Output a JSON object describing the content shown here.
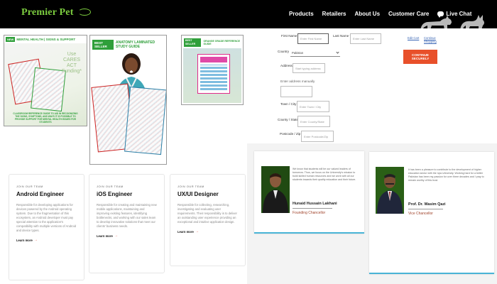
{
  "nav": {
    "logo": "Premier Pet",
    "links": [
      "Products",
      "Retailers",
      "About Us",
      "Customer Care"
    ],
    "live_chat": "Live Chat"
  },
  "products": {
    "mental_health": {
      "new_badge": "NEW",
      "title": "MENTAL HEALTH | SIGNS & SUPPORT",
      "cares": "Use CARES ACT Funding*",
      "footer": "CLASSROOM REFERENCE GUIDE TO AID IN RECOGNIZING THE SIGNS, SYMPTOMS, AND WAYS IT IS POSSIBLE TO PROVIDE SUPPORT FOR MENTAL HEALTH ISSUES FOR STUDENTS"
    },
    "anatomy": {
      "badge": "BEST SELLER",
      "title": "ANATOMY LAMINATED STUDY GUIDE"
    },
    "grade": {
      "badge": "BEST SELLER",
      "title": "ORANGE GRADE REFERENCE GUIDE"
    }
  },
  "jobs": [
    {
      "eyebrow": "JOIN OUR TEAM",
      "role": "Android Engineer",
      "desc": "Responsible for developing applications for devices powered by the Android operating system. Due to the fragmentation of this ecosystem, an Android developer must pay special attention to the application's compatibility with multiple versions of Android and device types.",
      "link": "Learn more"
    },
    {
      "eyebrow": "JOIN OUR TEAM",
      "role": "iOS Engineer",
      "desc": "Responsible for creating and maintaining new mobile applications, maintaining and improving existing features, identifying bottlenecks, and working with our sales team to develop innovative solutions that meet our clients' business needs.",
      "link": "Learn more"
    },
    {
      "eyebrow": "JOIN OUR TEAM",
      "role": "UX/UI Designer",
      "desc": "Responsible for collecting, researching, investigating and evaluating user requirements. Their responsibility is to deliver an outstanding user experience providing an exceptional and intuitive application design.",
      "link": "Learn more"
    }
  ],
  "form": {
    "first_name_label": "First Name *",
    "first_name_placeholder": "Enter First Name",
    "last_name_label": "Last Name *",
    "last_name_placeholder": "Enter Last Name",
    "country_label": "Country",
    "country_value": "Pakistan",
    "address_label": "Address *",
    "address_placeholder": "Start typing address",
    "address_link": "Enter address manually",
    "town_label": "Town / City *",
    "town_placeholder": "Enter Town / City",
    "county_label": "County / State",
    "county_placeholder": "Enter County/State",
    "postcode_label": "Postcode / Zip *",
    "postcode_placeholder": "Enter Postcode/Zip",
    "edit_cart": "Edit Cart",
    "continue_shopping": "Continue Shopping",
    "continue_button": "CONTINUE SECURELY"
  },
  "people": [
    {
      "quote": "We know that students will be our valued leaders of tomorrow. Thus, we focus on the University's mission to build skilled human resources and we work with all our students towards their quality education and their future.",
      "name": "Hunaid Hussain Lakhani",
      "title": "Founding Chancellor"
    },
    {
      "quote": "It has been a pleasure to contribute to the development of higher education sector with the Iqra University. Working hard for a better Pakistan has been my passion for over three decades and I pray to remain worthy of this trust.",
      "name": "Prof. Dr. Wasim Qazi",
      "title": "Vice Chancellor"
    }
  ],
  "colors": {
    "nav_bg": "#000000",
    "logo_green": "#7ccd3f",
    "accent_orange": "#e8502a",
    "card_accent": "#49b4d6",
    "title_brown": "#a0432b"
  }
}
